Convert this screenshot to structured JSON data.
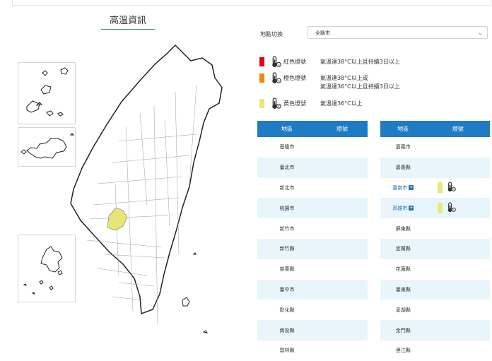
{
  "page": {
    "title": "高溫資訊"
  },
  "filter": {
    "label": "地點切換",
    "selected": "全縣市"
  },
  "legend": [
    {
      "color": "#e60012",
      "name": "紅色燈號",
      "lines": [
        "氣溫達38°C以上且持續3日以上"
      ]
    },
    {
      "color": "#f08a00",
      "name": "橙色燈號",
      "lines": [
        "氣溫達38°C以上或",
        "氣溫達36°C以上且持續3日以上"
      ]
    },
    {
      "color": "#e8e87a",
      "name": "黃色燈號",
      "lines": [
        "氣溫達36°C以上"
      ]
    }
  ],
  "table": {
    "headers": {
      "area": "地區",
      "signal": "燈號"
    },
    "left": [
      {
        "area": "基隆市"
      },
      {
        "area": "臺北市"
      },
      {
        "area": "新北市"
      },
      {
        "area": "桃園市"
      },
      {
        "area": "新竹市"
      },
      {
        "area": "新竹縣"
      },
      {
        "area": "苗栗縣"
      },
      {
        "area": "臺中市"
      },
      {
        "area": "彰化縣"
      },
      {
        "area": "南投縣"
      },
      {
        "area": "雲林縣"
      }
    ],
    "right": [
      {
        "area": "嘉義市"
      },
      {
        "area": "嘉義縣"
      },
      {
        "area": "臺南市",
        "link": true,
        "signal": "yellow"
      },
      {
        "area": "高雄市",
        "link": true,
        "signal": "yellow"
      },
      {
        "area": "屏東縣"
      },
      {
        "area": "宜蘭縣"
      },
      {
        "area": "花蓮縣"
      },
      {
        "area": "臺東縣"
      },
      {
        "area": "澎湖縣"
      },
      {
        "area": "金門縣"
      },
      {
        "area": "連江縣"
      }
    ]
  },
  "colors": {
    "header": "#1f7bc4",
    "row_alt": "#e8f6fb",
    "yellow": "#e8e87a",
    "highlight_area": "#e6e676"
  },
  "icons": {
    "thermometer": "thermometer-icon",
    "plus": "plus-icon",
    "chevron": "chevron-down-icon"
  }
}
